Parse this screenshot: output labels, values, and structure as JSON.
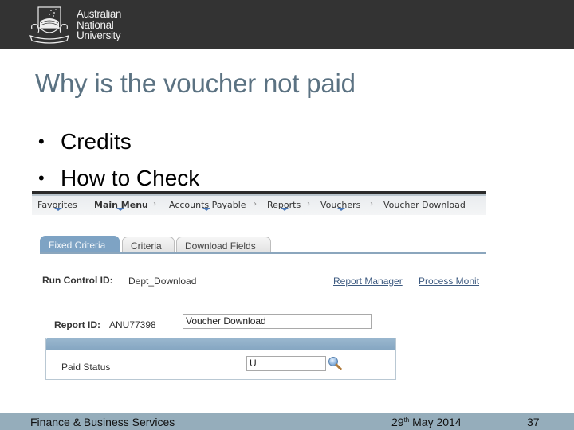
{
  "header": {
    "logo_lines": [
      "Australian",
      "National",
      "University"
    ]
  },
  "slide": {
    "title": "Why is the voucher not paid",
    "bullets": [
      "Credits",
      "How to Check"
    ],
    "bullet_glyph": "•"
  },
  "screenshot": {
    "nav": {
      "items": [
        {
          "label": "Favorites",
          "has_dropdown": true
        },
        {
          "label": "Main Menu",
          "has_dropdown": true,
          "bold": true
        },
        {
          "label": "Accounts Payable",
          "has_dropdown": true
        },
        {
          "label": "Reports",
          "has_dropdown": true
        },
        {
          "label": "Vouchers",
          "has_dropdown": true
        },
        {
          "label": "Voucher Download",
          "has_dropdown": false
        }
      ],
      "separator": "›"
    },
    "tabs": [
      {
        "label": "Fixed Criteria",
        "active": true
      },
      {
        "label": "Criteria",
        "active": false
      },
      {
        "label": "Download Fields",
        "active": false
      }
    ],
    "run_control": {
      "label": "Run Control ID:",
      "value": "Dept_Download"
    },
    "links": {
      "report_manager": "Report Manager",
      "process_monitor": "Process Monit"
    },
    "report": {
      "label": "Report ID:",
      "value": "ANU77398",
      "description_value": "Voucher Download"
    },
    "paid_status": {
      "label": "Paid Status",
      "value": "U",
      "lookup_icon": "magnifier-icon"
    },
    "colors": {
      "tab_active": "#7ea3c4",
      "link": "#3d5a80",
      "group_header": "#8fb0c9"
    }
  },
  "footer": {
    "department": "Finance & Business Services",
    "date_day": "29",
    "date_suffix": "th",
    "date_rest": " May 2014",
    "page_number": "37"
  },
  "colors": {
    "header_bg": "#333333",
    "title": "#5b7282",
    "footer_bg": "#95adbb"
  }
}
